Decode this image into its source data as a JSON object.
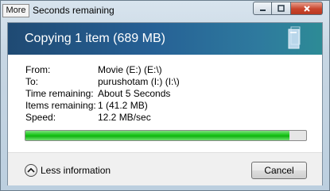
{
  "window": {
    "title": "Seconds remaining",
    "more_label": "More"
  },
  "banner": {
    "title": "Copying 1 item (689 MB)"
  },
  "details": [
    {
      "label": "From:",
      "value": "Movie (E:) (E:\\)"
    },
    {
      "label": "To:",
      "value": "purushotam (I:) (I:\\)"
    },
    {
      "label": "Time remaining:",
      "value": "About 5 Seconds"
    },
    {
      "label": "Items remaining:",
      "value": "1 (41.2 MB)"
    },
    {
      "label": "Speed:",
      "value": "12.2 MB/sec"
    }
  ],
  "progress": {
    "fraction": 0.94,
    "color": "#18c618"
  },
  "footer": {
    "less_info_label": "Less information",
    "cancel_label": "Cancel"
  },
  "icons": {
    "more": "more-icon",
    "minimize": "minimize-icon",
    "maximize": "maximize-icon",
    "close": "close-icon",
    "chevron": "chevron-up-icon",
    "file": "file-copy-icon"
  }
}
